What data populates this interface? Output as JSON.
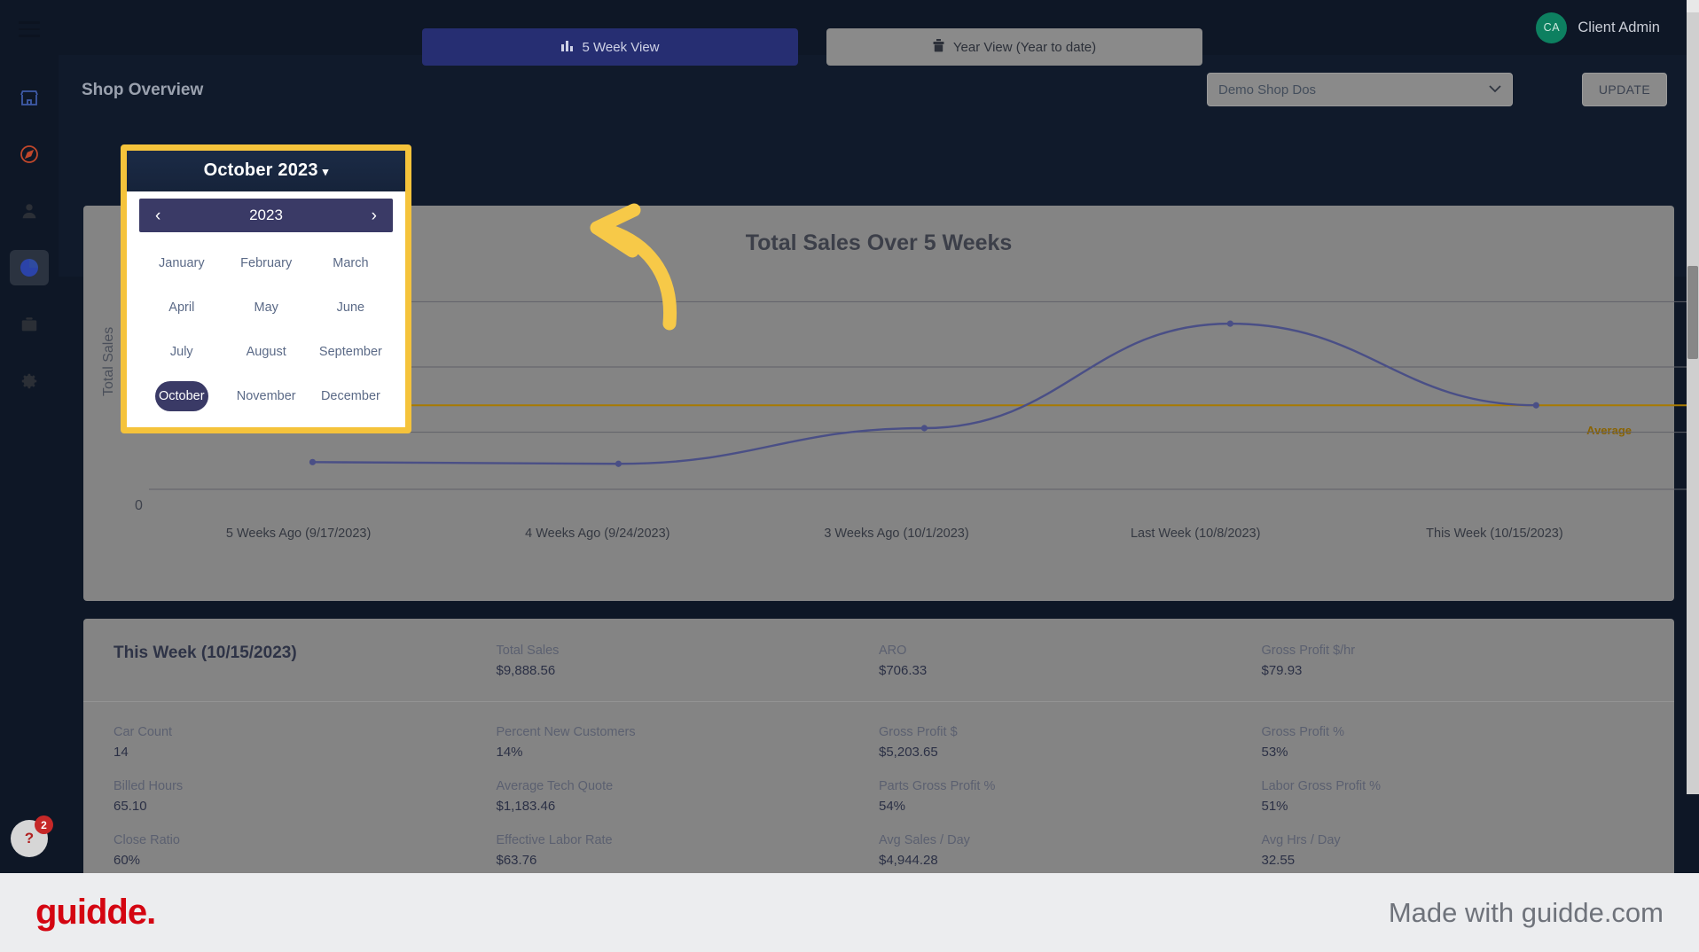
{
  "sidebar": {
    "menu_icon": "hamburger-icon",
    "items": [
      {
        "icon": "store-icon",
        "name": "shops"
      },
      {
        "icon": "compass-icon",
        "name": "explore"
      },
      {
        "icon": "person-icon",
        "name": "users"
      },
      {
        "icon": "pie-chart-icon",
        "name": "reports",
        "active": true
      },
      {
        "icon": "briefcase-icon",
        "name": "inventory"
      },
      {
        "icon": "gear-icon",
        "name": "settings"
      }
    ],
    "help_badge_label": "?",
    "help_badge_count": "2"
  },
  "topbar": {
    "avatar_initials": "CA",
    "username": "Client Admin"
  },
  "subheader": {
    "page_title": "Shop Overview",
    "shop_select_value": "Demo Shop Dos",
    "chevron": "⌄",
    "update_label": "UPDATE"
  },
  "tabs": [
    {
      "label": "5 Week View",
      "icon": "bar-chart-icon",
      "active": true
    },
    {
      "label": "Year View (Year to date)",
      "icon": "calendar-icon",
      "active": false
    }
  ],
  "datepicker": {
    "header_label": "October 2023",
    "caret": "▾",
    "year": "2023",
    "prev_arrow": "‹",
    "next_arrow": "›",
    "months": [
      "January",
      "February",
      "March",
      "April",
      "May",
      "June",
      "July",
      "August",
      "September",
      "October",
      "November",
      "December"
    ],
    "selected_month": "October",
    "border_color": "#f5c33b"
  },
  "chart_data": {
    "type": "line",
    "title": "Total Sales Over 5 Weeks",
    "xlabel": "",
    "ylabel": "Total Sales",
    "categories": [
      "5 Weeks Ago (9/17/2023)",
      "4 Weeks Ago (9/24/2023)",
      "3 Weeks Ago (10/1/2023)",
      "Last Week (10/8/2023)",
      "This Week (10/15/2023)"
    ],
    "values": [
      3200,
      3000,
      7200,
      19500,
      9888.56
    ],
    "ylim": [
      0,
      24000
    ],
    "ytick_labels": [
      "0"
    ],
    "average_line": {
      "label": "Average",
      "value": 9888,
      "color": "#a87a00"
    },
    "line_color": "#4a4f86",
    "grid": true,
    "legend": "none"
  },
  "metrics": {
    "week_title": "This Week (10/15/2023)",
    "top_row": [
      {
        "label": "Total Sales",
        "value": "$9,888.56"
      },
      {
        "label": "ARO",
        "value": "$706.33"
      },
      {
        "label": "Gross Profit $/hr",
        "value": "$79.93"
      }
    ],
    "grid": [
      [
        {
          "label": "Car Count",
          "value": "14"
        },
        {
          "label": "Percent New Customers",
          "value": "14%"
        },
        {
          "label": "Gross Profit $",
          "value": "$5,203.65"
        },
        {
          "label": "Gross Profit %",
          "value": "53%"
        }
      ],
      [
        {
          "label": "Billed Hours",
          "value": "65.10"
        },
        {
          "label": "Average Tech Quote",
          "value": "$1,183.46"
        },
        {
          "label": "Parts Gross Profit %",
          "value": "54%"
        },
        {
          "label": "Labor Gross Profit %",
          "value": "51%"
        }
      ],
      [
        {
          "label": "Close Ratio",
          "value": "60%"
        },
        {
          "label": "Effective Labor Rate",
          "value": "$63.76"
        },
        {
          "label": "Avg Sales / Day",
          "value": "$4,944.28"
        },
        {
          "label": "Avg Hrs / Day",
          "value": "32.55"
        }
      ]
    ]
  },
  "footer": {
    "logo": "guidde.",
    "made_with": "Made with guidde.com",
    "logo_color": "#d40511"
  }
}
